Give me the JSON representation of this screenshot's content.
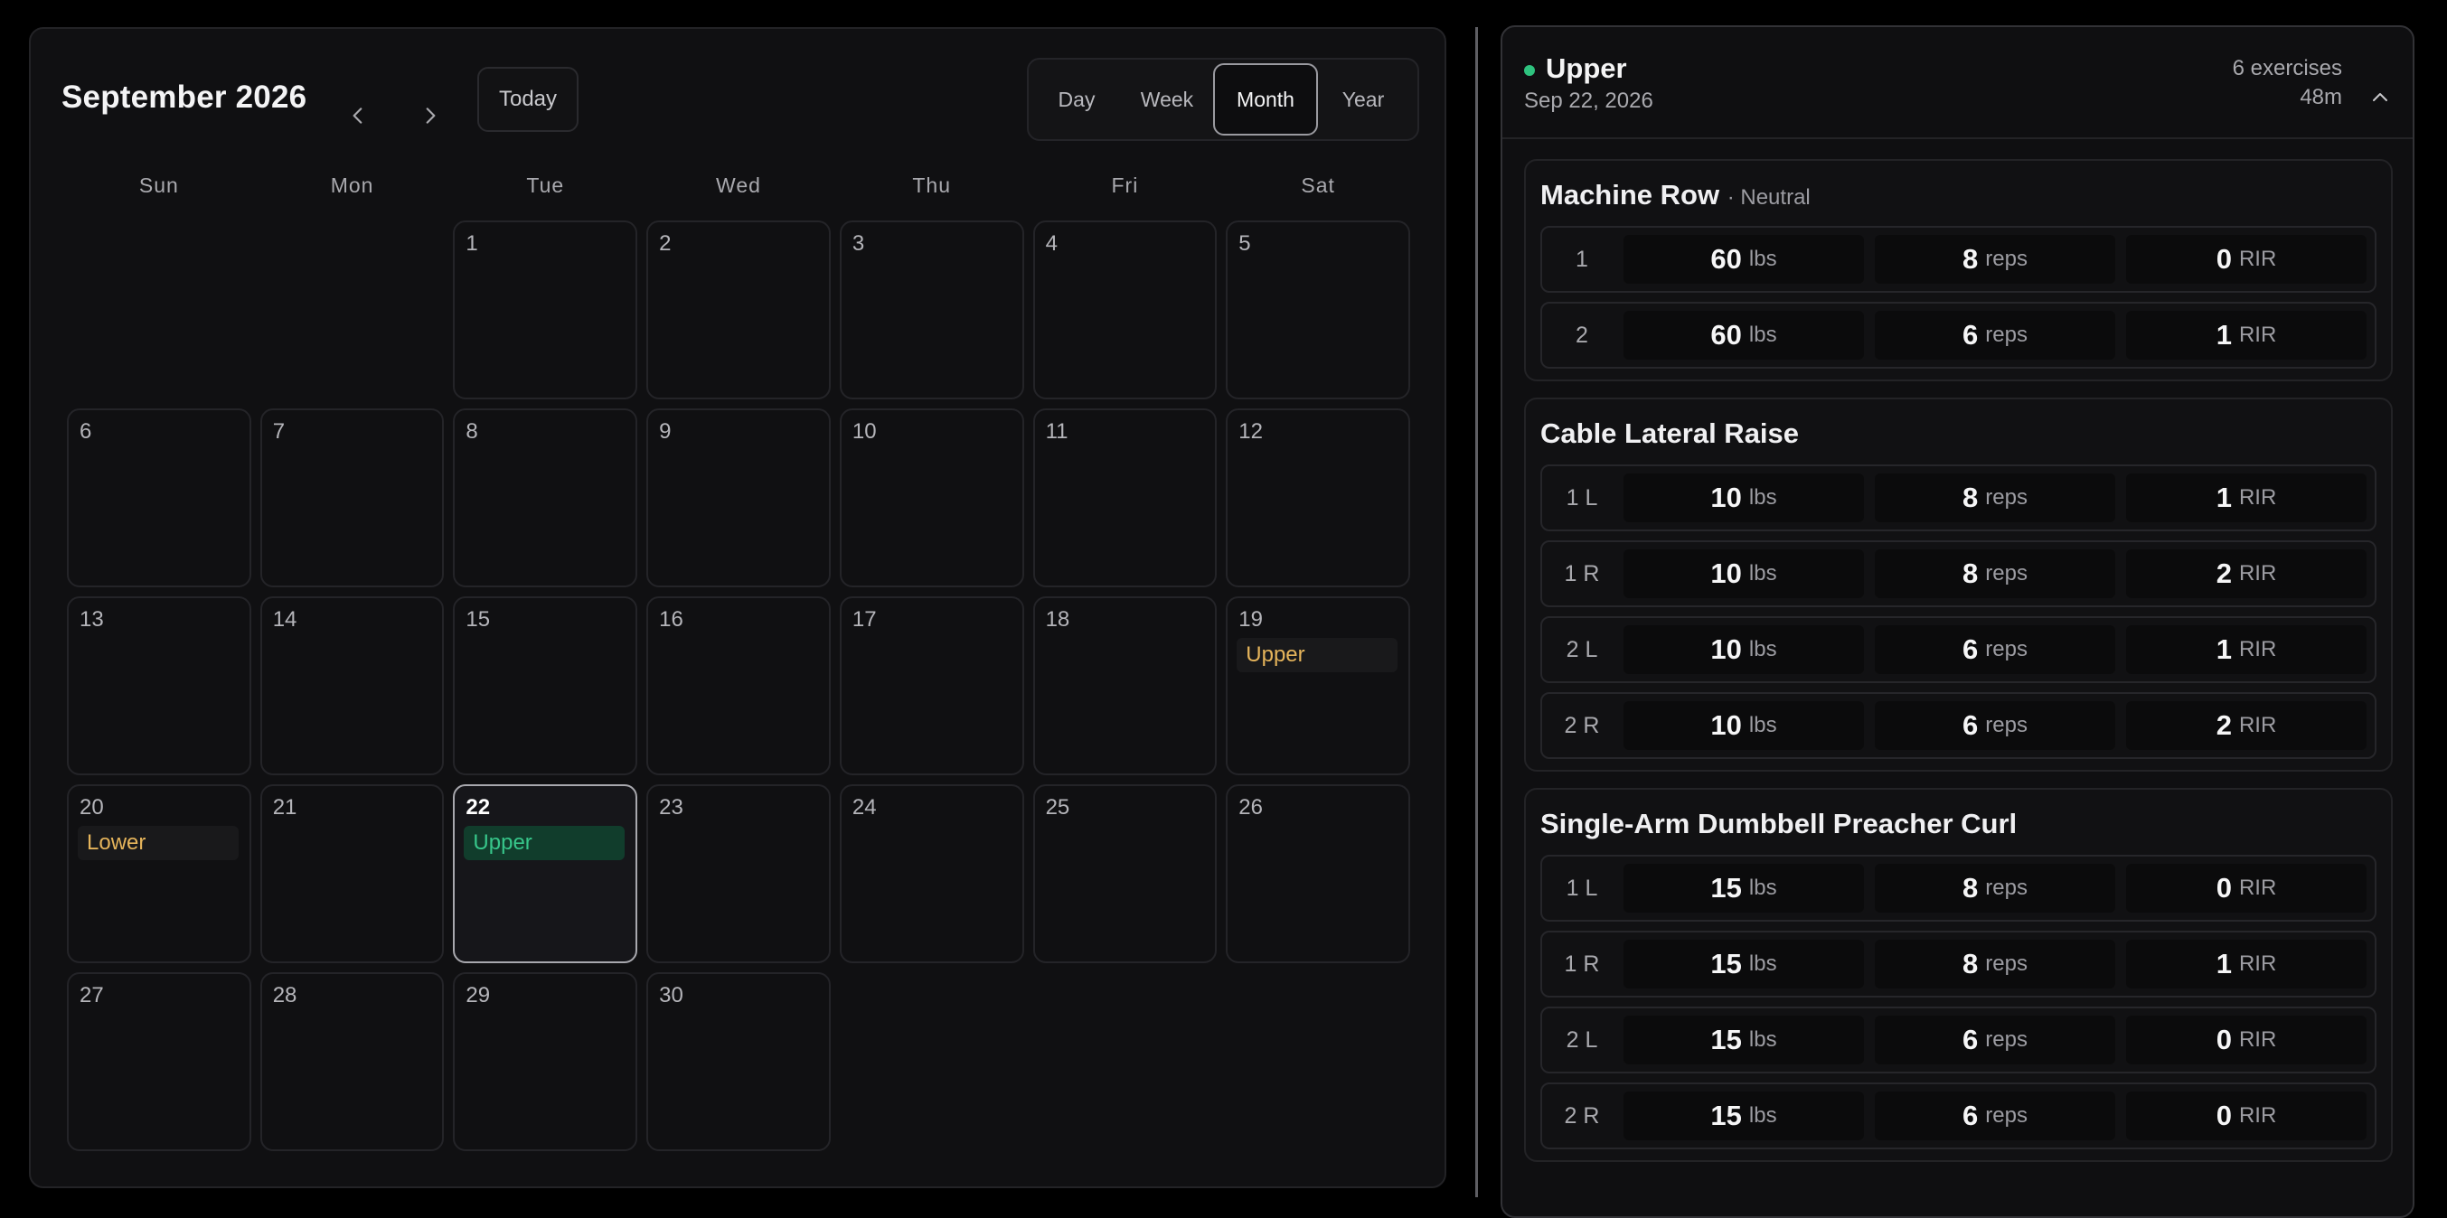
{
  "calendar": {
    "month_title": "September 2026",
    "today_label": "Today",
    "views": [
      "Day",
      "Week",
      "Month",
      "Year"
    ],
    "active_view": "Month",
    "weekdays": [
      "Sun",
      "Mon",
      "Tue",
      "Wed",
      "Thu",
      "Fri",
      "Sat"
    ],
    "days": [
      {
        "num": ""
      },
      {
        "num": ""
      },
      {
        "num": "1"
      },
      {
        "num": "2"
      },
      {
        "num": "3"
      },
      {
        "num": "4"
      },
      {
        "num": "5"
      },
      {
        "num": "6"
      },
      {
        "num": "7"
      },
      {
        "num": "8"
      },
      {
        "num": "9"
      },
      {
        "num": "10"
      },
      {
        "num": "11"
      },
      {
        "num": "12"
      },
      {
        "num": "13"
      },
      {
        "num": "14"
      },
      {
        "num": "15"
      },
      {
        "num": "16"
      },
      {
        "num": "17"
      },
      {
        "num": "18"
      },
      {
        "num": "19",
        "event": "Upper",
        "event_color": "yellow"
      },
      {
        "num": "20",
        "event": "Lower",
        "event_color": "yellow"
      },
      {
        "num": "21"
      },
      {
        "num": "22",
        "event": "Upper",
        "event_color": "green",
        "selected": true
      },
      {
        "num": "23"
      },
      {
        "num": "24"
      },
      {
        "num": "25"
      },
      {
        "num": "26"
      },
      {
        "num": "27"
      },
      {
        "num": "28"
      },
      {
        "num": "29"
      },
      {
        "num": "30"
      }
    ]
  },
  "workout": {
    "name": "Upper",
    "date": "Sep 22, 2026",
    "exercise_count": "6 exercises",
    "duration": "48m",
    "status_color": "#2ec27e"
  },
  "exercises": [
    {
      "name": "Machine Row",
      "variant": "· Neutral",
      "sets": [
        {
          "label": "1",
          "weight": "60",
          "weight_unit": "lbs",
          "reps": "8",
          "reps_unit": "reps",
          "rir": "0",
          "rir_unit": "RIR"
        },
        {
          "label": "2",
          "weight": "60",
          "weight_unit": "lbs",
          "reps": "6",
          "reps_unit": "reps",
          "rir": "1",
          "rir_unit": "RIR"
        }
      ]
    },
    {
      "name": "Cable Lateral Raise",
      "variant": "",
      "sets": [
        {
          "label": "1 L",
          "weight": "10",
          "weight_unit": "lbs",
          "reps": "8",
          "reps_unit": "reps",
          "rir": "1",
          "rir_unit": "RIR"
        },
        {
          "label": "1 R",
          "weight": "10",
          "weight_unit": "lbs",
          "reps": "8",
          "reps_unit": "reps",
          "rir": "2",
          "rir_unit": "RIR"
        },
        {
          "label": "2 L",
          "weight": "10",
          "weight_unit": "lbs",
          "reps": "6",
          "reps_unit": "reps",
          "rir": "1",
          "rir_unit": "RIR"
        },
        {
          "label": "2 R",
          "weight": "10",
          "weight_unit": "lbs",
          "reps": "6",
          "reps_unit": "reps",
          "rir": "2",
          "rir_unit": "RIR"
        }
      ]
    },
    {
      "name": "Single-Arm Dumbbell Preacher Curl",
      "variant": "",
      "sets": [
        {
          "label": "1 L",
          "weight": "15",
          "weight_unit": "lbs",
          "reps": "8",
          "reps_unit": "reps",
          "rir": "0",
          "rir_unit": "RIR"
        },
        {
          "label": "1 R",
          "weight": "15",
          "weight_unit": "lbs",
          "reps": "8",
          "reps_unit": "reps",
          "rir": "1",
          "rir_unit": "RIR"
        },
        {
          "label": "2 L",
          "weight": "15",
          "weight_unit": "lbs",
          "reps": "6",
          "reps_unit": "reps",
          "rir": "0",
          "rir_unit": "RIR"
        },
        {
          "label": "2 R",
          "weight": "15",
          "weight_unit": "lbs",
          "reps": "6",
          "reps_unit": "reps",
          "rir": "0",
          "rir_unit": "RIR"
        }
      ]
    }
  ],
  "icons": {
    "prev": "chevron-left-icon",
    "next": "chevron-right-icon",
    "collapse": "chevron-up-icon"
  }
}
